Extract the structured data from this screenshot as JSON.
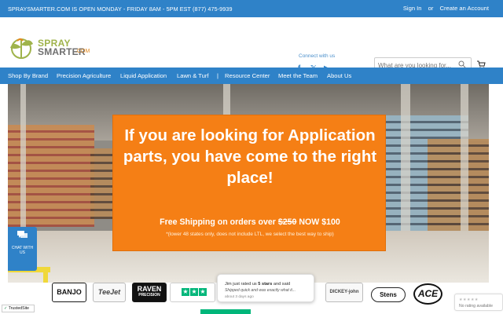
{
  "topbar": {
    "announcement": "SPRAYSMARTER.COM IS OPEN MONDAY - FRIDAY 8AM - 5PM EST (877) 475-9939",
    "signin": "Sign In",
    "or": "or",
    "create_account": "Create an Account",
    "background_color": "#2f82c8"
  },
  "logo": {
    "line_1": "SPRAY",
    "line_2": "SMARTER",
    "suffix": ".COM",
    "accent_green": "#9fb34b",
    "accent_orange": "#e48a1f"
  },
  "header": {
    "connect_label": "Connect with us",
    "social_icons": [
      "facebook-icon",
      "x-icon",
      "youtube-icon"
    ],
    "search_placeholder": "What are you looking for...",
    "cart_icon": "cart-icon"
  },
  "nav": {
    "items": [
      "Shop By Brand",
      "Precision Agriculture",
      "Liquid Application",
      "Lawn & Turf",
      "|",
      "Resource Center",
      "Meet the Team",
      "About Us"
    ],
    "background_color": "#2f82c8"
  },
  "hero": {
    "headline": "If you are looking for Application parts, you have come to the right place!",
    "shipping_prefix": "Free Shipping on orders over",
    "old_price": "$250",
    "shipping_suffix": "NOW $100",
    "note": "*(lower 48 states only, does not include LTL, we select the best way to ship)",
    "overlay_color": "#f57f15"
  },
  "chat": {
    "label": "CHAT WITH US",
    "icon": "chat-icon"
  },
  "brands": {
    "items": [
      "BANJO",
      "TeeJet",
      "RAVEN",
      "PRECISION",
      "TRUSTPILOT",
      "DICKEY-john",
      "Stens",
      "ACE"
    ],
    "raven_subtitle": "PRECISION"
  },
  "review_popup": {
    "name_prefix": "Jim just rated us",
    "rating": "5 stars",
    "name_suffix": "and said",
    "quote": "Shipped quick and was exactly what it...",
    "time": "about 3 days ago"
  },
  "trustedsite": {
    "label": "TrustedSite"
  },
  "review_card": {
    "status": "No rating available"
  }
}
